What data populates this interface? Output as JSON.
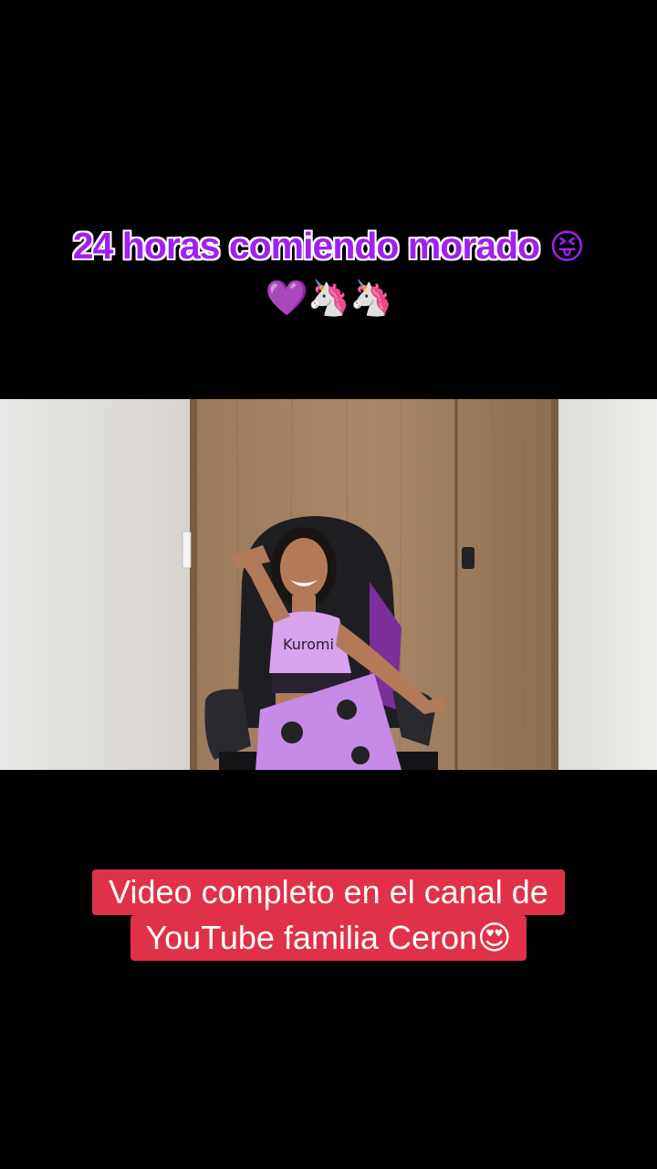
{
  "top_caption": {
    "line1_text": "24 horas comiendo morado",
    "line1_emoji": "😝",
    "line2_emoji": "💜🦄🦄"
  },
  "video": {
    "shirt_text": "Kuromi"
  },
  "bottom_caption": {
    "line1": "Video completo en el canal de",
    "line2_text": "YouTube familia Ceron",
    "line2_emoji": "😍",
    "background": "#e03148"
  }
}
